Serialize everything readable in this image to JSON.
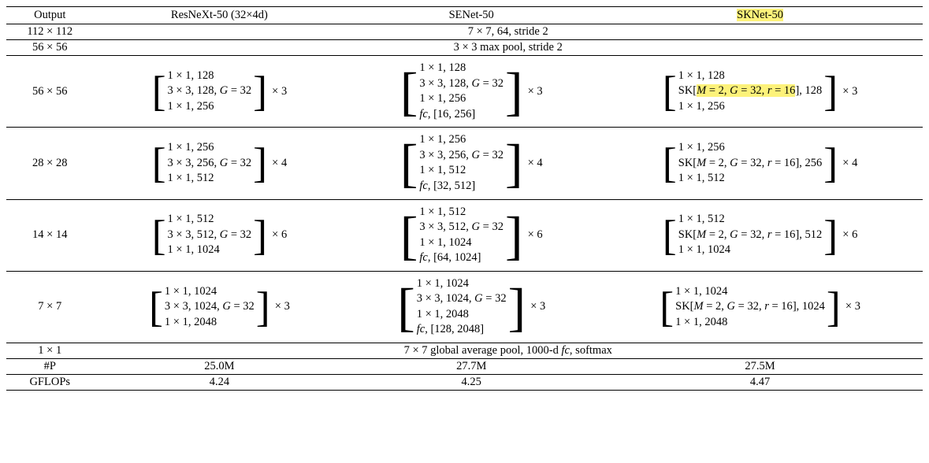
{
  "headers": {
    "output": "Output",
    "resnext": "ResNeXt-50 (32×4d)",
    "senet": "SENet-50",
    "sknet": "SKNet-50"
  },
  "row_112": {
    "out": "112 × 112",
    "span": "7 × 7, 64, stride 2"
  },
  "row_56pool": {
    "out": "56 × 56",
    "span": "3 × 3 max pool, stride 2"
  },
  "row_56": {
    "out": "56 × 56",
    "resnext": {
      "l1": "1 × 1, 128",
      "l2a": "3 × 3, 128, ",
      "l2b": "G",
      "l2c": " = 32",
      "l3": "1 × 1, 256"
    },
    "senet": {
      "l1": "1 × 1, 128",
      "l2a": "3 × 3, 128, ",
      "l2b": "G",
      "l2c": " = 32",
      "l3": "1 × 1, 256",
      "l4a": "fc",
      "l4b": ", [16, 256]"
    },
    "sknet": {
      "l1": "1 × 1, 128",
      "l2a": "SK[",
      "l2b": "M",
      "l2c": " = 2, ",
      "l2d": "G",
      "l2e": " = 32, ",
      "l2f": "r",
      "l2g": " = 16",
      "l2h": "], 128",
      "l3": "1 × 1, 256"
    },
    "mult": "× 3"
  },
  "row_28": {
    "out": "28 × 28",
    "resnext": {
      "l1": "1 × 1, 256",
      "l2a": "3 × 3, 256, ",
      "l2b": "G",
      "l2c": " = 32",
      "l3": "1 × 1, 512"
    },
    "senet": {
      "l1": "1 × 1, 256",
      "l2a": "3 × 3, 256, ",
      "l2b": "G",
      "l2c": " = 32",
      "l3": "1 × 1, 512",
      "l4a": "fc",
      "l4b": ", [32, 512]"
    },
    "sknet": {
      "l1": "1 × 1, 256",
      "l2a": "SK[",
      "l2b": "M",
      "l2c": " = 2, ",
      "l2d": "G",
      "l2e": " = 32, ",
      "l2f": "r",
      "l2g": " = 16",
      "l2h": "], 256",
      "l3": "1 × 1, 512"
    },
    "mult": "× 4"
  },
  "row_14": {
    "out": "14 × 14",
    "resnext": {
      "l1": "1 × 1, 512",
      "l2a": "3 × 3, 512, ",
      "l2b": "G",
      "l2c": " = 32",
      "l3": "1 × 1, 1024"
    },
    "senet": {
      "l1": "1 × 1, 512",
      "l2a": "3 × 3, 512, ",
      "l2b": "G",
      "l2c": " = 32",
      "l3": "1 × 1, 1024",
      "l4a": "fc",
      "l4b": ", [64, 1024]"
    },
    "sknet": {
      "l1": "1 × 1, 512",
      "l2a": "SK[",
      "l2b": "M",
      "l2c": " = 2, ",
      "l2d": "G",
      "l2e": " = 32, ",
      "l2f": "r",
      "l2g": " = 16",
      "l2h": "], 512",
      "l3": "1 × 1, 1024"
    },
    "mult": "× 6"
  },
  "row_7": {
    "out": "7 × 7",
    "resnext": {
      "l1": "1 × 1, 1024",
      "l2a": "3 × 3, 1024, ",
      "l2b": "G",
      "l2c": " = 32",
      "l3": "1 × 1, 2048"
    },
    "senet": {
      "l1": "1 × 1, 1024",
      "l2a": "3 × 3, 1024, ",
      "l2b": "G",
      "l2c": " = 32",
      "l3": "1 × 1, 2048",
      "l4a": "fc",
      "l4b": ", [128, 2048]"
    },
    "sknet": {
      "l1": "1 × 1, 1024",
      "l2a": "SK[",
      "l2b": "M",
      "l2c": " = 2, ",
      "l2d": "G",
      "l2e": " = 32, ",
      "l2f": "r",
      "l2g": " = 16",
      "l2h": "], 1024",
      "l3": "1 × 1, 2048"
    },
    "mult": "× 3"
  },
  "row_1": {
    "out": "1 × 1",
    "span_a": "7 × 7 global average pool, 1000-d ",
    "span_b": "fc",
    "span_c": ", softmax"
  },
  "row_p": {
    "out": "#P",
    "resnext": "25.0M",
    "senet": "27.7M",
    "sknet": "27.5M"
  },
  "row_flops": {
    "out": "GFLOPs",
    "resnext": "4.24",
    "senet": "4.25",
    "sknet": "4.47"
  },
  "chart_data": {
    "type": "table",
    "title": "Architecture specifications for ResNeXt-50, SENet-50 and SKNet-50",
    "columns": [
      "Output",
      "ResNeXt-50 (32×4d)",
      "SENet-50",
      "SKNet-50"
    ],
    "rows": [
      {
        "Output": "112×112",
        "ResNeXt-50": "7×7,64,stride 2",
        "SENet-50": "7×7,64,stride 2",
        "SKNet-50": "7×7,64,stride 2"
      },
      {
        "Output": "56×56",
        "ResNeXt-50": "3×3 max pool, stride 2",
        "SENet-50": "3×3 max pool, stride 2",
        "SKNet-50": "3×3 max pool, stride 2"
      },
      {
        "Output": "56×56",
        "ResNeXt-50": "[1×1,128; 3×3,128,G=32; 1×1,256]×3",
        "SENet-50": "[1×1,128; 3×3,128,G=32; 1×1,256; fc,[16,256]]×3",
        "SKNet-50": "[1×1,128; SK[M=2,G=32,r=16],128; 1×1,256]×3"
      },
      {
        "Output": "28×28",
        "ResNeXt-50": "[1×1,256; 3×3,256,G=32; 1×1,512]×4",
        "SENet-50": "[1×1,256; 3×3,256,G=32; 1×1,512; fc,[32,512]]×4",
        "SKNet-50": "[1×1,256; SK[M=2,G=32,r=16],256; 1×1,512]×4"
      },
      {
        "Output": "14×14",
        "ResNeXt-50": "[1×1,512; 3×3,512,G=32; 1×1,1024]×6",
        "SENet-50": "[1×1,512; 3×3,512,G=32; 1×1,1024; fc,[64,1024]]×6",
        "SKNet-50": "[1×1,512; SK[M=2,G=32,r=16],512; 1×1,1024]×6"
      },
      {
        "Output": "7×7",
        "ResNeXt-50": "[1×1,1024; 3×3,1024,G=32; 1×1,2048]×3",
        "SENet-50": "[1×1,1024; 3×3,1024,G=32; 1×1,2048; fc,[128,2048]]×3",
        "SKNet-50": "[1×1,1024; SK[M=2,G=32,r=16],1024; 1×1,2048]×3"
      },
      {
        "Output": "1×1",
        "ResNeXt-50": "7×7 global average pool, 1000-d fc, softmax",
        "SENet-50": "(same)",
        "SKNet-50": "(same)"
      },
      {
        "Output": "#P",
        "ResNeXt-50": "25.0M",
        "SENet-50": "27.7M",
        "SKNet-50": "27.5M"
      },
      {
        "Output": "GFLOPs",
        "ResNeXt-50": "4.24",
        "SENet-50": "4.25",
        "SKNet-50": "4.47"
      }
    ]
  }
}
